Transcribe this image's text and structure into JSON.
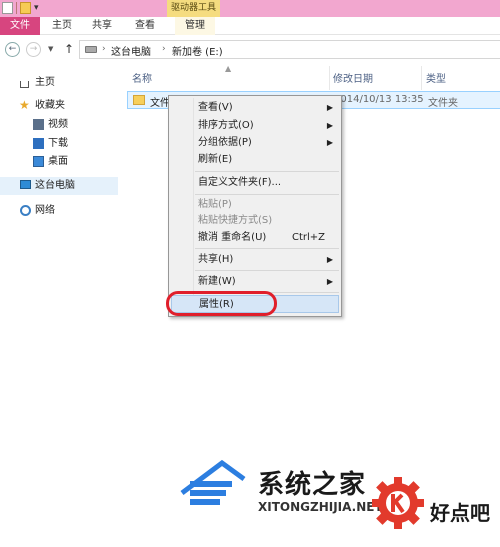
{
  "titlebar": {
    "contextual_tab_label": "驱动器工具"
  },
  "ribbon": {
    "tabs": [
      "文件",
      "主页",
      "共享",
      "查看",
      "管理"
    ]
  },
  "addressbar": {
    "crumbs": [
      "这台电脑",
      "新加卷 (E:)"
    ]
  },
  "navpane": {
    "items": [
      {
        "label": "主页",
        "icon": "home-icon"
      },
      {
        "label": "收藏夹",
        "icon": "star-icon"
      },
      {
        "label": "视频",
        "icon": "video-folder-icon"
      },
      {
        "label": "下载",
        "icon": "download-folder-icon"
      },
      {
        "label": "桌面",
        "icon": "desktop-folder-icon"
      },
      {
        "label": "这台电脑",
        "icon": "computer-icon"
      },
      {
        "label": "网络",
        "icon": "network-icon"
      }
    ]
  },
  "columns": {
    "name": "名称",
    "date": "修改日期",
    "type": "类型"
  },
  "files": [
    {
      "name": "文件",
      "date": "2014/10/13 13:35",
      "type": "文件夹"
    }
  ],
  "context_menu": {
    "items": [
      {
        "label": "查看(V)",
        "submenu": true
      },
      {
        "label": "排序方式(O)",
        "submenu": true
      },
      {
        "label": "分组依据(P)",
        "submenu": true
      },
      {
        "label": "刷新(E)"
      },
      {
        "label": "自定义文件夹(F)..."
      },
      {
        "label": "粘贴(P)",
        "disabled": true
      },
      {
        "label": "粘贴快捷方式(S)",
        "disabled": true
      },
      {
        "label": "撤消 重命名(U)",
        "shortcut": "Ctrl+Z"
      },
      {
        "label": "共享(H)",
        "submenu": true
      },
      {
        "label": "新建(W)",
        "submenu": true
      },
      {
        "label": "属性(R)",
        "highlighted": true
      }
    ]
  },
  "watermark": {
    "site_title": "系统之家",
    "site_url": "XITONGZHIJIA.NET",
    "brand": "好点吧"
  },
  "colors": {
    "titlebar": "#f2a7cf",
    "file_tab": "#d7457f",
    "contextual_tab": "#f5dc7f",
    "highlight_ring": "#e01f2b",
    "selection": "#e5f3ff"
  }
}
